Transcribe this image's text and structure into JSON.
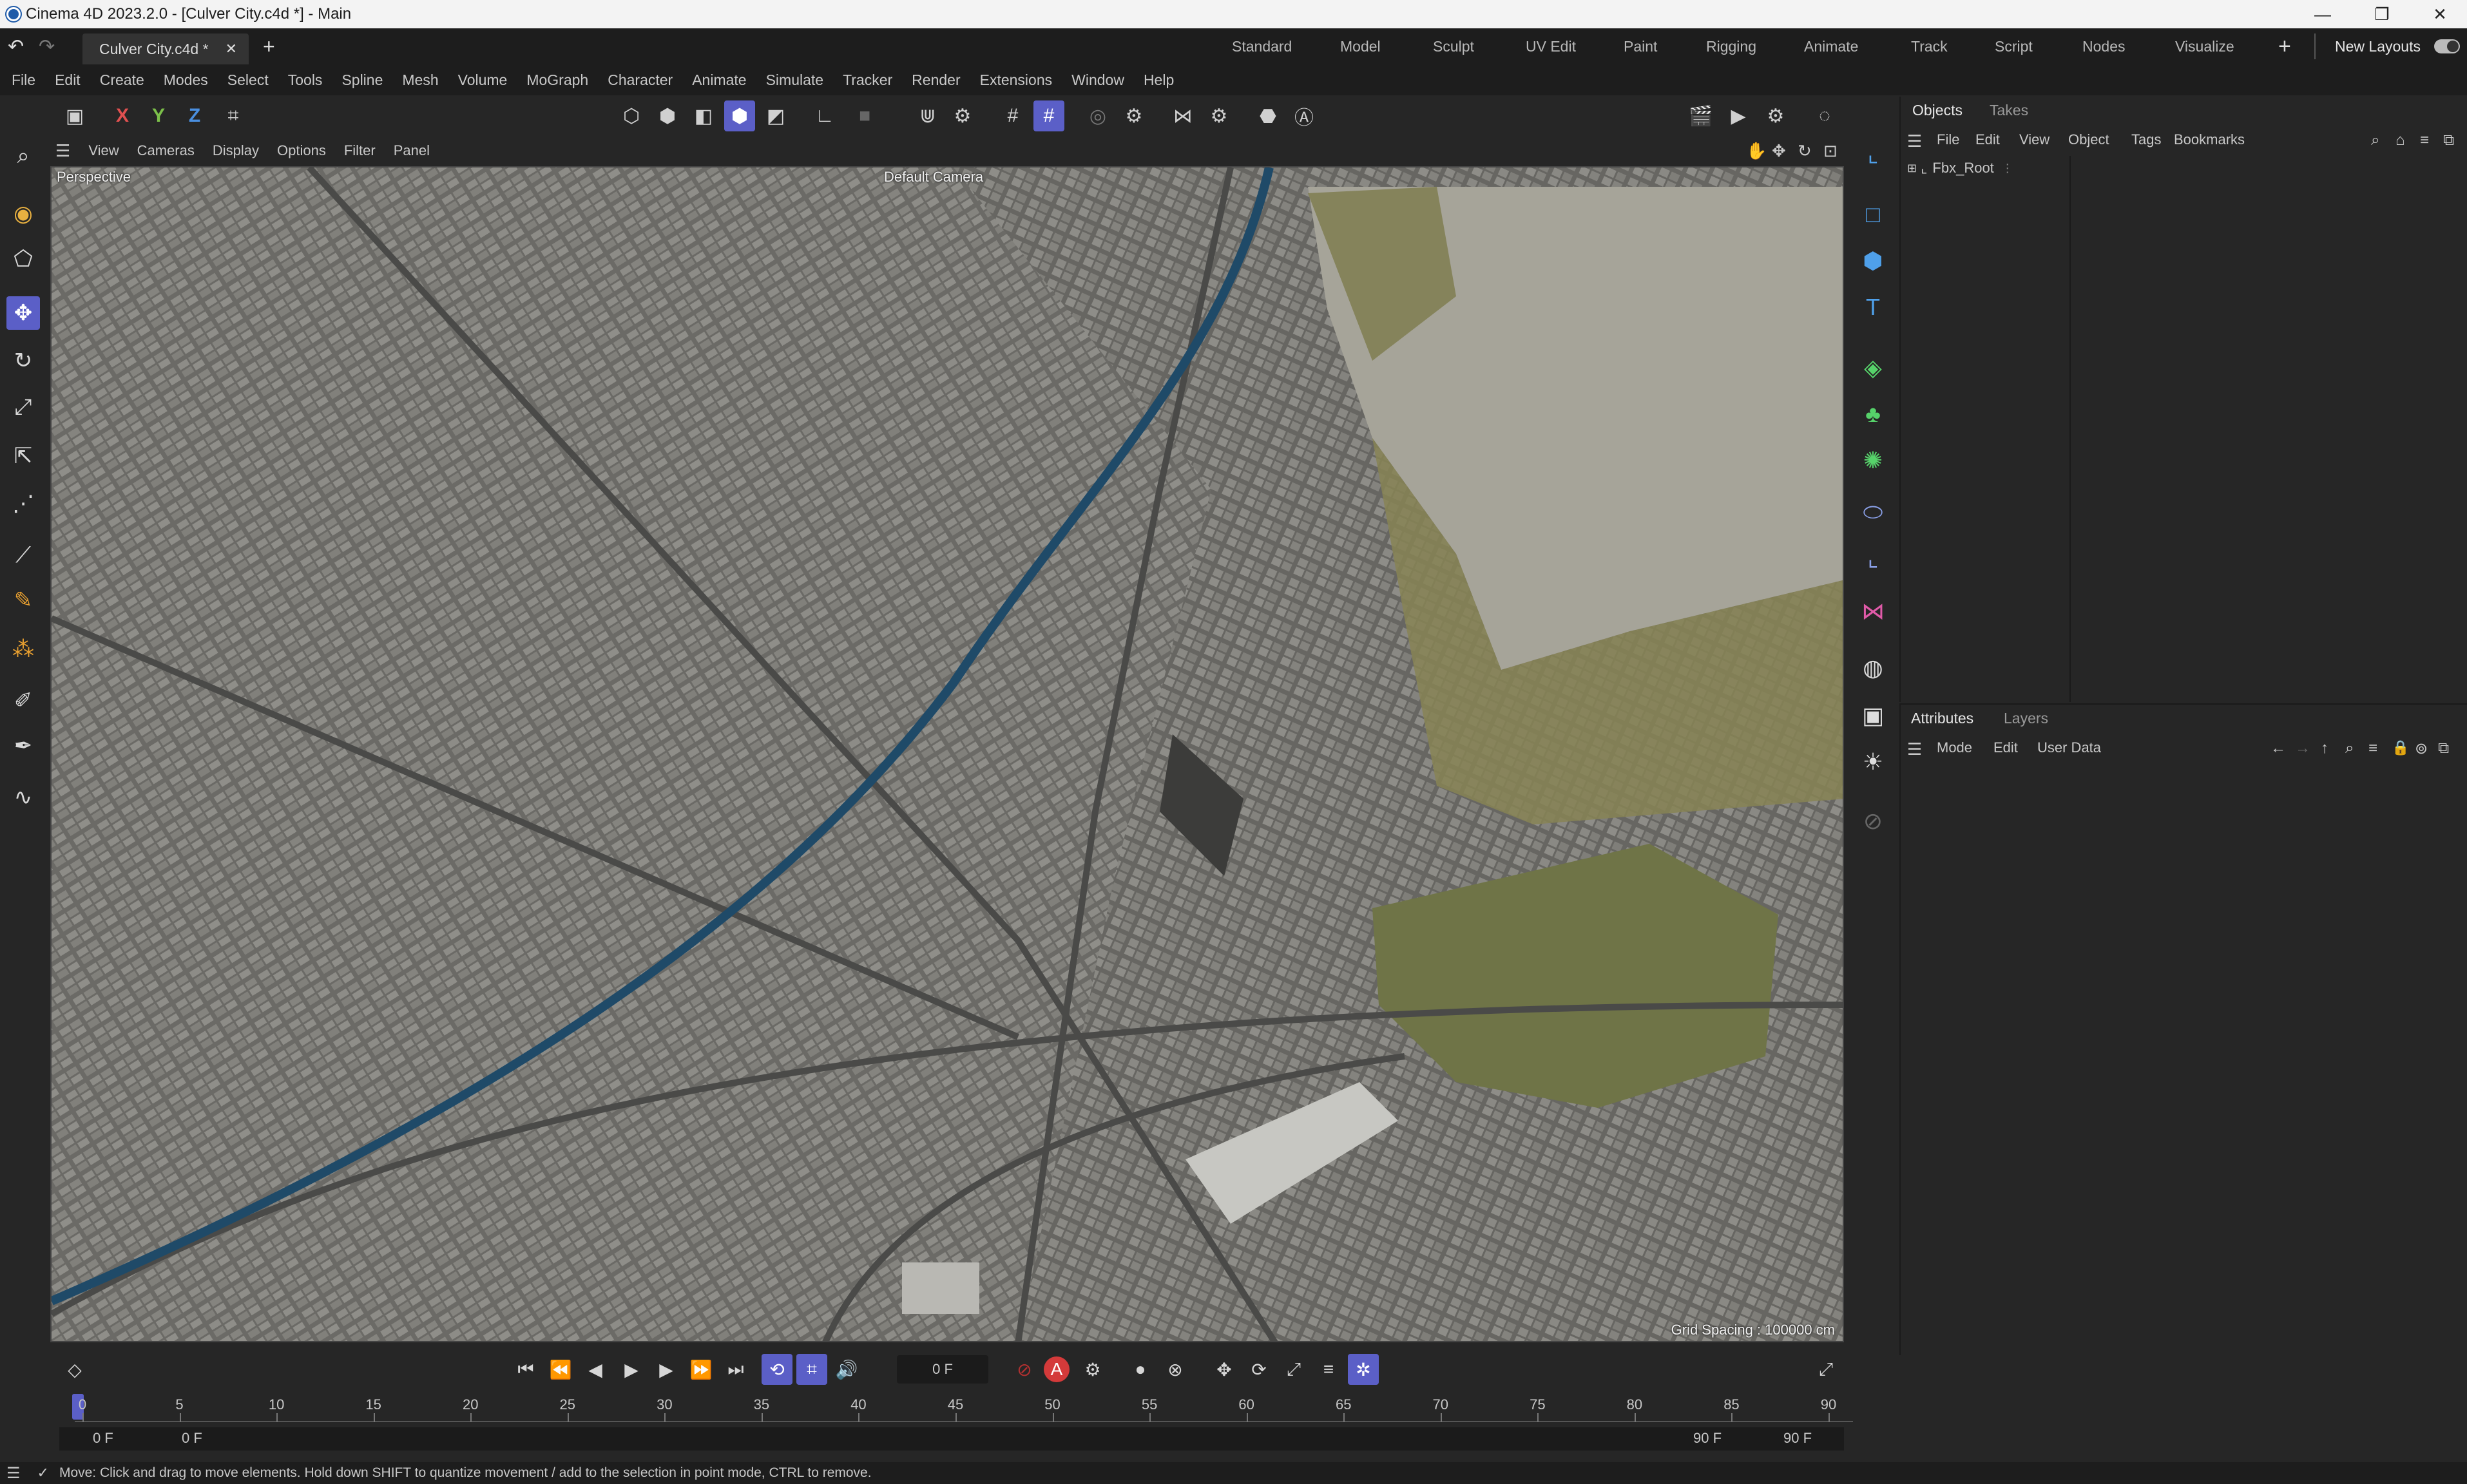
{
  "window": {
    "title": "Cinema 4D 2023.2.0 - [Culver City.c4d *] - Main",
    "controls": [
      "minimize-icon",
      "restore-icon",
      "close-icon"
    ]
  },
  "doc_tabs": [
    {
      "label": "Culver City.c4d *"
    }
  ],
  "layouts": {
    "tabs": [
      "Standard",
      "Model",
      "Sculpt",
      "UV Edit",
      "Paint",
      "Rigging",
      "Animate",
      "Track",
      "Script",
      "Nodes",
      "Visualize"
    ],
    "new_layouts": "New Layouts"
  },
  "menu": [
    "File",
    "Edit",
    "Create",
    "Modes",
    "Select",
    "Tools",
    "Spline",
    "Mesh",
    "Volume",
    "MoGraph",
    "Character",
    "Animate",
    "Simulate",
    "Tracker",
    "Render",
    "Extensions",
    "Window",
    "Help"
  ],
  "toolbar": {
    "axis_x": "X",
    "axis_y": "Y",
    "axis_z": "Z"
  },
  "viewport": {
    "menu": [
      "View",
      "Cameras",
      "Display",
      "Options",
      "Filter",
      "Panel"
    ],
    "projection": "Perspective",
    "camera": "Default Camera",
    "grid_spacing": "Grid Spacing : 100000 cm"
  },
  "objects_panel": {
    "tabs": [
      "Objects",
      "Takes"
    ],
    "menu": [
      "File",
      "Edit",
      "View",
      "Object",
      "Tags",
      "Bookmarks"
    ],
    "items": [
      {
        "name": "Fbx_Root"
      }
    ]
  },
  "attributes_panel": {
    "tabs": [
      "Attributes",
      "Layers"
    ],
    "menu": [
      "Mode",
      "Edit",
      "User Data"
    ]
  },
  "timeline": {
    "current_frame": "0 F",
    "ticks": [
      "0",
      "5",
      "10",
      "15",
      "20",
      "25",
      "30",
      "35",
      "40",
      "45",
      "50",
      "55",
      "60",
      "65",
      "70",
      "75",
      "80",
      "85",
      "90"
    ],
    "range_start": "0 F",
    "range_start2": "0 F",
    "range_end": "90 F",
    "range_end2": "90 F"
  },
  "status": {
    "message": "Move: Click and drag to move elements. Hold down SHIFT to quantize movement / add to the selection in point mode, CTRL to remove."
  },
  "colors": {
    "accent": "#5b5fc7",
    "bg": "#262626",
    "dark": "#1d1d1d"
  }
}
